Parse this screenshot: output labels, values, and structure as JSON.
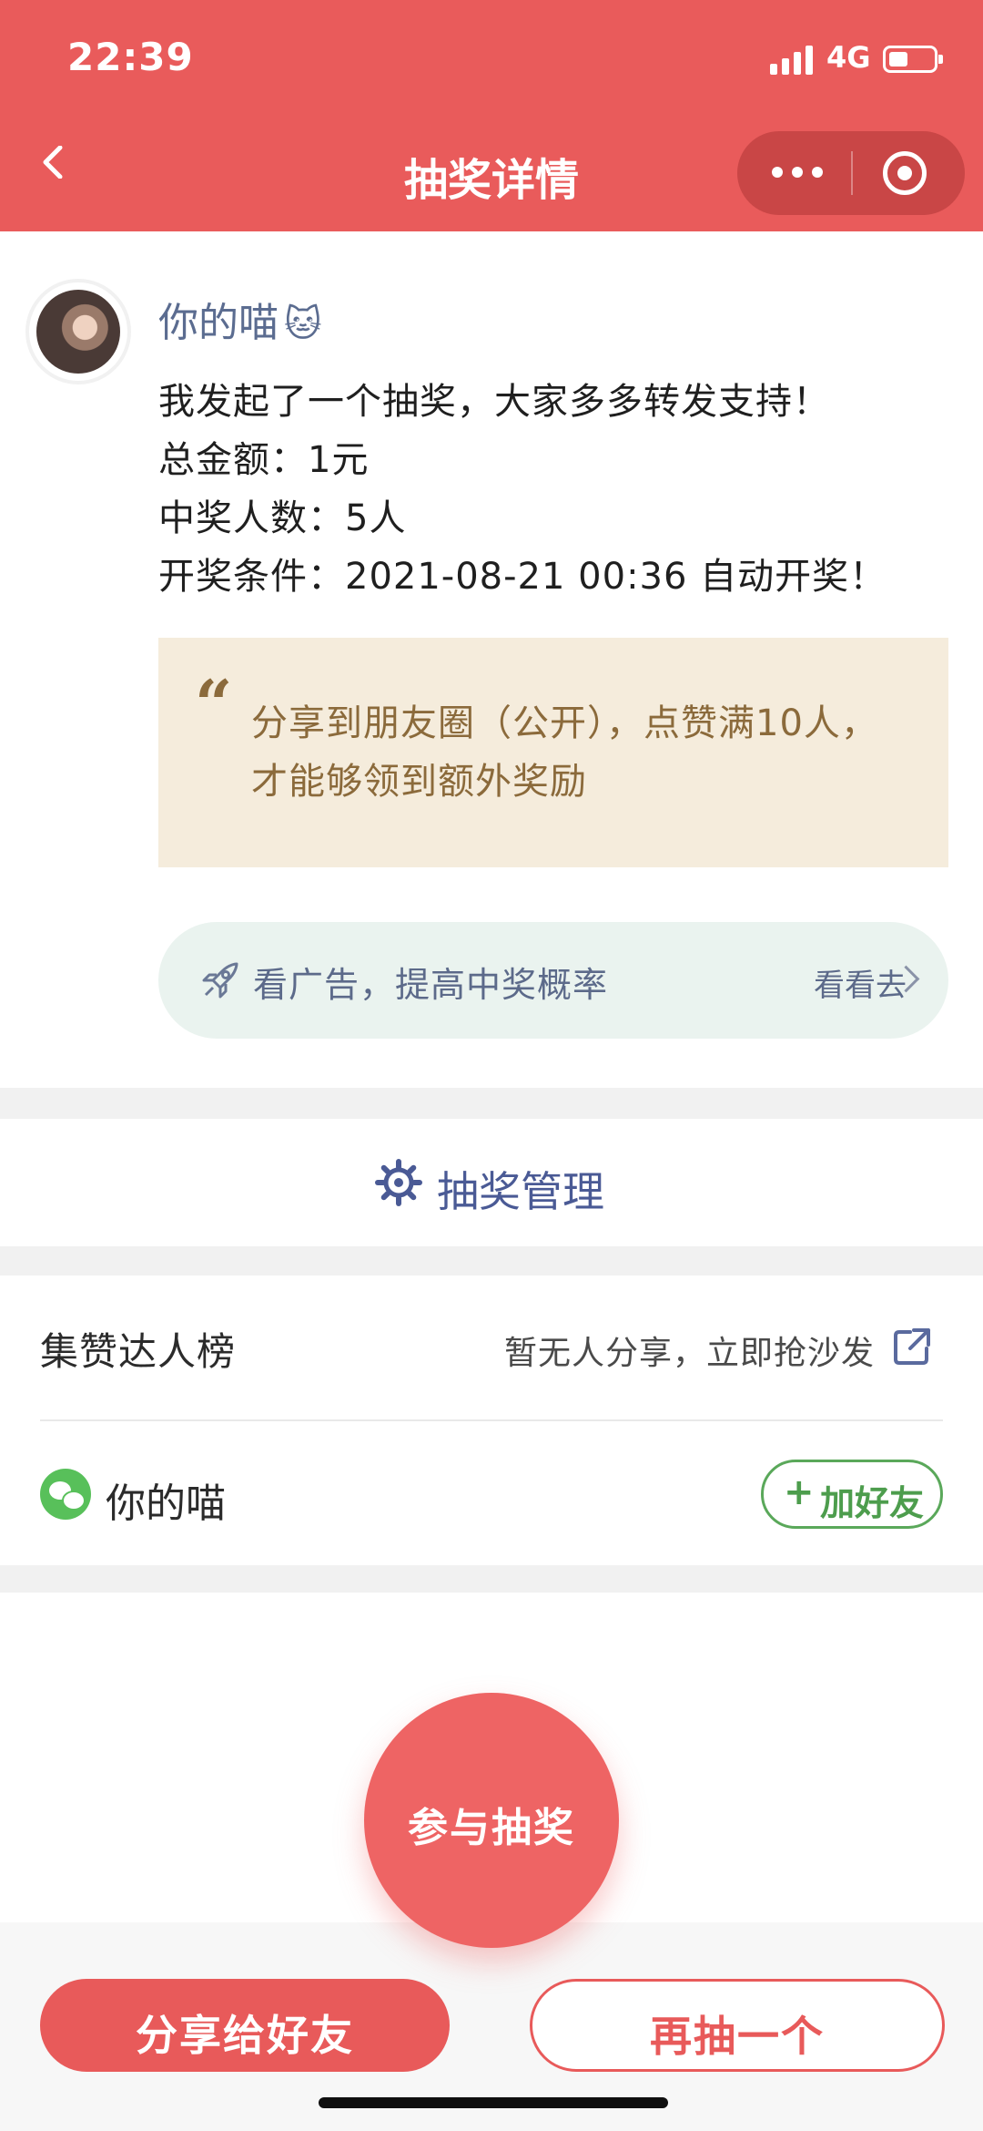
{
  "status_bar": {
    "time": "22:39",
    "network": "4G"
  },
  "header": {
    "title": "抽奖详情"
  },
  "post": {
    "author": "你的喵",
    "author_emoji": "🐱",
    "lines": [
      "我发起了一个抽奖，大家多多转发支持！",
      "总金额：1元",
      "中奖人数：5人",
      "开奖条件：2021-08-21 00:36 自动开奖！"
    ],
    "quote_mark": "“",
    "quote_text": "分享到朋友圈（公开），点赞满10人，才能够领到额外奖励"
  },
  "ad": {
    "text": "看广告，提高中奖概率",
    "link": "看看去"
  },
  "manage": {
    "label": "抽奖管理"
  },
  "ranking": {
    "title": "集赞达人榜",
    "note": "暂无人分享，立即抢沙发",
    "member_name": "你的喵",
    "add_friend_plus": "+",
    "add_friend_label": "加好友"
  },
  "join": {
    "label": "参与抽奖"
  },
  "bottom": {
    "share_label": "分享给好友",
    "again_label": "再抽一个"
  },
  "colors": {
    "brand_red": "#e95b5b",
    "wechat_green": "#58c05a"
  },
  "icons": [
    "back-icon",
    "more-icon",
    "close-miniprogram-icon",
    "rocket-icon",
    "chevron-right-icon",
    "gear-icon",
    "share-external-icon",
    "wechat-icon"
  ]
}
